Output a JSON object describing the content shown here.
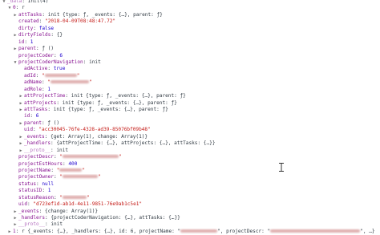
{
  "console": {
    "lines": [
      {
        "indent": 0,
        "arrow": "down",
        "key": "_data",
        "dim": true,
        "sep": ": ",
        "segs": [
          {
            "t": "Init(4)",
            "c": "g"
          }
        ]
      },
      {
        "indent": 1,
        "arrow": "down",
        "key": "0",
        "sep": ": ",
        "segs": [
          {
            "t": "r",
            "c": "g"
          }
        ]
      },
      {
        "indent": 2,
        "arrow": "right",
        "key": "attTasks",
        "sep": ": ",
        "segs": [
          {
            "t": "init {type: ƒ, _events: {…}, parent: ƒ}",
            "c": "g"
          }
        ]
      },
      {
        "indent": 2,
        "key": "created",
        "sep": ": ",
        "segs": [
          {
            "t": "\"2018-04-09T08:48:47.72\"",
            "c": "s"
          }
        ]
      },
      {
        "indent": 2,
        "key": "dirty",
        "sep": ": ",
        "segs": [
          {
            "t": "false",
            "c": "n"
          }
        ]
      },
      {
        "indent": 2,
        "arrow": "right",
        "key": "dirtyFields",
        "sep": ": ",
        "segs": [
          {
            "t": "{}",
            "c": "g"
          }
        ]
      },
      {
        "indent": 2,
        "key": "id",
        "sep": ": ",
        "segs": [
          {
            "t": "1",
            "c": "n"
          }
        ]
      },
      {
        "indent": 2,
        "arrow": "right",
        "key": "parent",
        "sep": ": ",
        "segs": [
          {
            "t": "ƒ ()",
            "c": "g"
          }
        ]
      },
      {
        "indent": 2,
        "key": "projectCoder",
        "sep": ": ",
        "segs": [
          {
            "t": "6",
            "c": "n"
          }
        ]
      },
      {
        "indent": 2,
        "arrow": "down",
        "key": "projectCoderNavigation",
        "sep": ": ",
        "segs": [
          {
            "t": "init",
            "c": "g"
          }
        ]
      },
      {
        "indent": 3,
        "key": "adActive",
        "sep": ": ",
        "segs": [
          {
            "t": "true",
            "c": "n"
          }
        ]
      },
      {
        "indent": 3,
        "key": "adId",
        "sep": ": ",
        "segs": [
          {
            "t": "\"",
            "c": "s"
          },
          {
            "blur": 40
          },
          {
            "t": "\"",
            "c": "s"
          }
        ]
      },
      {
        "indent": 3,
        "key": "adName",
        "sep": ": ",
        "segs": [
          {
            "t": "\"",
            "c": "s"
          },
          {
            "blur": 48
          },
          {
            "t": "\"",
            "c": "s"
          }
        ]
      },
      {
        "indent": 3,
        "key": "adRole",
        "sep": ": ",
        "segs": [
          {
            "t": "1",
            "c": "n"
          }
        ]
      },
      {
        "indent": 3,
        "arrow": "right",
        "key": "attProjectTime",
        "sep": ": ",
        "segs": [
          {
            "t": "init {type: ƒ, _events: {…}, parent: ƒ}",
            "c": "g"
          }
        ]
      },
      {
        "indent": 3,
        "arrow": "right",
        "key": "attProjects",
        "sep": ": ",
        "segs": [
          {
            "t": "init {type: ƒ, _events: {…}, parent: ƒ}",
            "c": "g"
          }
        ]
      },
      {
        "indent": 3,
        "arrow": "right",
        "key": "attTasks",
        "sep": ": ",
        "segs": [
          {
            "t": "init {type: ƒ, _events: {…}, parent: ƒ}",
            "c": "g"
          }
        ]
      },
      {
        "indent": 3,
        "key": "id",
        "sep": ": ",
        "segs": [
          {
            "t": "6",
            "c": "n"
          }
        ]
      },
      {
        "indent": 3,
        "arrow": "right",
        "key": "parent",
        "sep": ": ",
        "segs": [
          {
            "t": "ƒ ()",
            "c": "g"
          }
        ]
      },
      {
        "indent": 3,
        "key": "uid",
        "sep": ": ",
        "segs": [
          {
            "t": "\"acc30045-76fe-4328-ad39-85076bf09b48\"",
            "c": "s"
          }
        ]
      },
      {
        "indent": 3,
        "arrow": "right",
        "key": "_events",
        "sep": ": ",
        "segs": [
          {
            "t": "{get: Array(1), change: Array(1)}",
            "c": "g"
          }
        ]
      },
      {
        "indent": 3,
        "arrow": "right",
        "key": "_handlers",
        "sep": ": ",
        "segs": [
          {
            "t": "{attProjectTime: {…}, attProjects: {…}, attTasks: {…}}",
            "c": "g"
          }
        ]
      },
      {
        "indent": 3,
        "arrow": "right",
        "key": "__proto__",
        "dim": true,
        "sep": ": ",
        "segs": [
          {
            "t": "init",
            "c": "g"
          }
        ]
      },
      {
        "indent": 2,
        "key": "projectDescr",
        "sep": ": ",
        "segs": [
          {
            "t": "\"",
            "c": "s"
          },
          {
            "blur": 70
          },
          {
            "t": "\"",
            "c": "s"
          }
        ]
      },
      {
        "indent": 2,
        "key": "projectEstHours",
        "sep": ": ",
        "segs": [
          {
            "t": "400",
            "c": "n"
          }
        ]
      },
      {
        "indent": 2,
        "key": "projectName",
        "sep": ": ",
        "segs": [
          {
            "t": "\"",
            "c": "s"
          },
          {
            "blur": 28
          },
          {
            "t": "\"",
            "c": "s"
          }
        ]
      },
      {
        "indent": 2,
        "key": "projectOwner",
        "sep": ": ",
        "segs": [
          {
            "t": "\"",
            "c": "s"
          },
          {
            "blur": 44
          },
          {
            "t": "\"",
            "c": "s"
          }
        ]
      },
      {
        "indent": 2,
        "key": "status",
        "sep": ": ",
        "segs": [
          {
            "t": "null",
            "c": "n"
          }
        ]
      },
      {
        "indent": 2,
        "key": "statusID",
        "sep": ": ",
        "segs": [
          {
            "t": "1",
            "c": "n"
          }
        ]
      },
      {
        "indent": 2,
        "key": "statusReason",
        "sep": ": ",
        "segs": [
          {
            "t": "\"",
            "c": "s"
          },
          {
            "blur": 30
          },
          {
            "t": "\"",
            "c": "s"
          }
        ]
      },
      {
        "indent": 2,
        "key": "uid",
        "sep": ": ",
        "segs": [
          {
            "t": "\"d723ef1d-ab1d-4e11-9851-76e9ab1c5e1\"",
            "c": "s"
          }
        ]
      },
      {
        "indent": 2,
        "arrow": "right",
        "key": "_events",
        "sep": ": ",
        "segs": [
          {
            "t": "{change: Array(1)}",
            "c": "g"
          }
        ]
      },
      {
        "indent": 2,
        "arrow": "right",
        "key": "_handlers",
        "sep": ": ",
        "segs": [
          {
            "t": "{projectCoderNavigation: {…}, attTasks: {…}}",
            "c": "g"
          }
        ]
      },
      {
        "indent": 2,
        "arrow": "right",
        "key": "__proto__",
        "dim": true,
        "sep": ": ",
        "segs": [
          {
            "t": "init",
            "c": "g"
          }
        ]
      },
      {
        "indent": 1,
        "arrow": "right",
        "key": "1",
        "sep": ": ",
        "segs": [
          {
            "t": "r {_events: {…}, _handlers: {…}, id: 6, projectName: \"",
            "c": "g"
          },
          {
            "blur": 46
          },
          {
            "t": "\", projectDescr: \"",
            "c": "g"
          },
          {
            "blur": 112
          },
          {
            "t": "\", …}",
            "c": "g"
          }
        ]
      }
    ]
  },
  "colors": {
    "key": "#881391",
    "string": "#c41a16",
    "number": "#1c00cf",
    "text": "#303942",
    "arrow": "#6e6e6e"
  },
  "icons": {
    "expanded": "triangle-down-icon",
    "collapsed": "triangle-right-icon",
    "cursor": "text-cursor-icon"
  }
}
